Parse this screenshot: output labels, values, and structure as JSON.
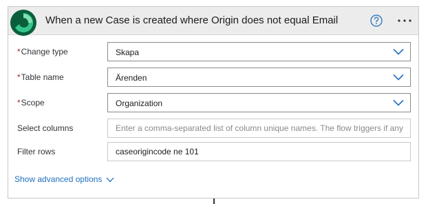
{
  "header": {
    "title": "When a new Case is created where Origin does not equal Email",
    "logo_icon": "dataverse-logo-icon",
    "help_icon": "help-circle-icon",
    "more_icon": "more-ellipsis-icon"
  },
  "fields": {
    "change_type": {
      "label": "Change type",
      "required_mark": "*",
      "value": "Skapa",
      "icon": "chevron-down-icon"
    },
    "table_name": {
      "label": "Table name",
      "required_mark": "*",
      "value": "Ärenden",
      "icon": "chevron-down-icon"
    },
    "scope": {
      "label": "Scope",
      "required_mark": "*",
      "value": "Organization",
      "icon": "chevron-down-icon"
    },
    "select_columns": {
      "label": "Select columns",
      "value": "",
      "placeholder": "Enter a comma-separated list of column unique names. The flow triggers if any"
    },
    "filter_rows": {
      "label": "Filter rows",
      "value": "caseorigincode ne 101",
      "placeholder": ""
    }
  },
  "advanced": {
    "label": "Show advanced options",
    "icon": "chevron-down-icon"
  },
  "colors": {
    "header_bg": "#ececec",
    "accent": "#1f6fbf",
    "required": "#a4262c",
    "logo_dark": "#0b5e3b",
    "logo_light": "#35c48a"
  }
}
